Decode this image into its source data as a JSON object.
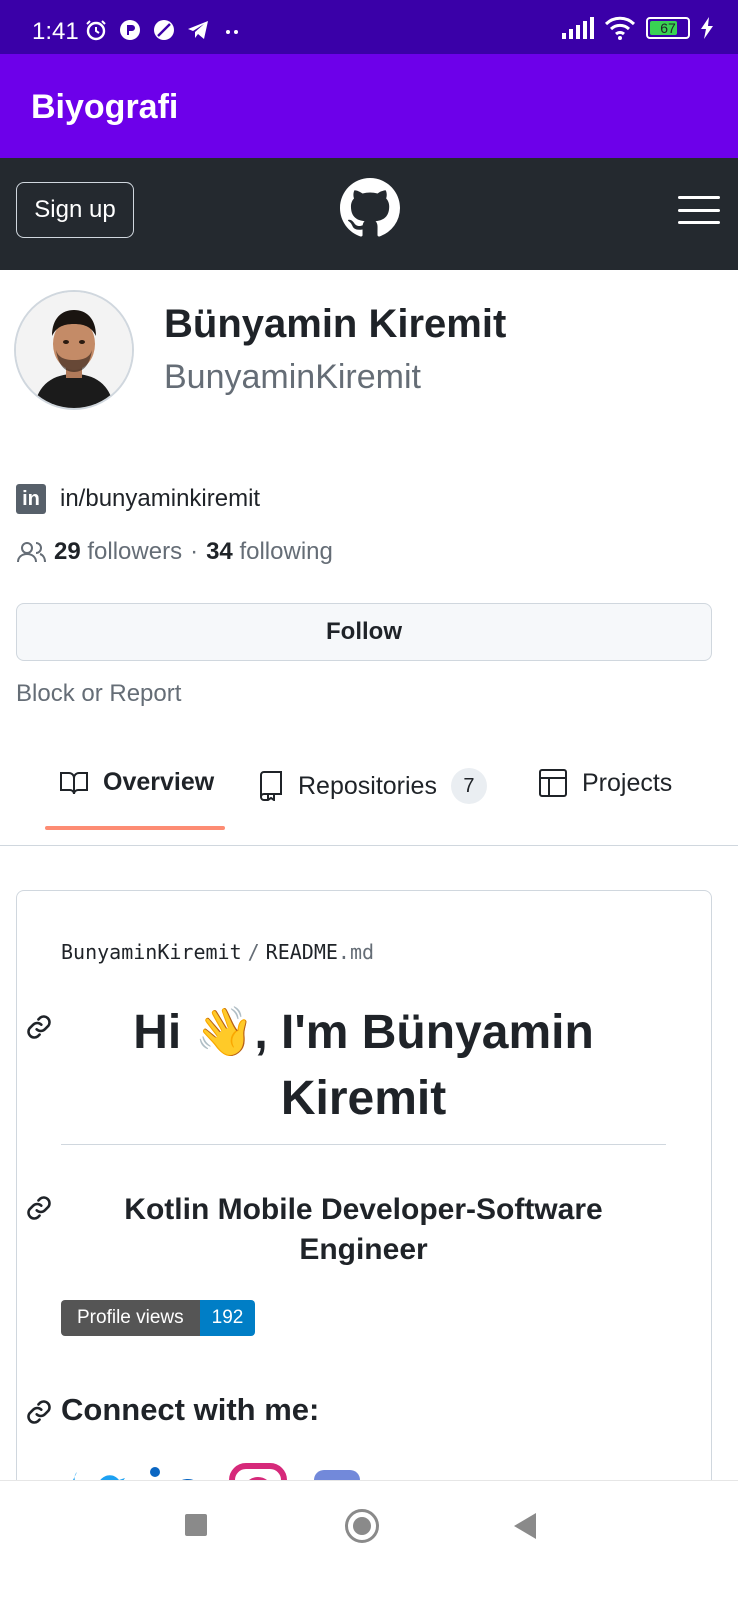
{
  "status_bar": {
    "time": "1:41",
    "battery": "67"
  },
  "app_bar": {
    "title": "Biyografi"
  },
  "gh_header": {
    "signup_label": "Sign up"
  },
  "profile": {
    "name": "Bünyamin Kiremit",
    "login": "BunyaminKiremit",
    "linkedin": "in/bunyaminkiremit",
    "followers_count": "29",
    "followers_label": "followers",
    "separator": "·",
    "following_count": "34",
    "following_label": "following",
    "follow_label": "Follow",
    "block_label": "Block or Report"
  },
  "tabs": [
    {
      "label": "Overview",
      "icon": "book-icon"
    },
    {
      "label": "Repositories",
      "icon": "repo-icon",
      "count": "7"
    },
    {
      "label": "Projects",
      "icon": "table-icon"
    }
  ],
  "readme": {
    "path_owner": "BunyaminKiremit",
    "path_sep": "/",
    "path_file": "README",
    "path_ext": ".md",
    "heading_part1": "Hi ",
    "heading_emoji": "👋",
    "heading_part2": ", I'm Bünyamin Kiremit",
    "subheading": "Kotlin Mobile Developer-Software Engineer",
    "badge_label": "Profile views",
    "badge_value": "192",
    "connect_heading": "Connect with me:"
  },
  "colors": {
    "status_bar": "#3a00a8",
    "app_bar": "#6d00ea",
    "gh_header": "#24292f",
    "tab_underline": "#fd8c73",
    "badge_value_bg": "#007ec6"
  }
}
